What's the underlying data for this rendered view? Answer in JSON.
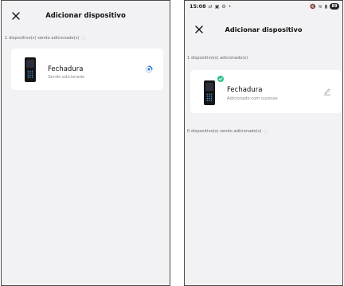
{
  "left_screen": {
    "title": "Adicionar dispositivo",
    "section_adding": "1 dispositivo(s) sendo adicionado(s)",
    "device": {
      "name": "Fechadura",
      "status": "Sendo adicionado",
      "image_icon": "door-lock-keypad",
      "state_icon": "loading-spinner"
    }
  },
  "right_screen": {
    "status_bar": {
      "time": "15:08",
      "left_icons": [
        "signal-arrows",
        "app-icon",
        "settings-icon",
        "dot"
      ],
      "battery": "89"
    },
    "title": "Adicionar dispositivo",
    "section_added": "1 dispositivo(s) adicionado(s)",
    "device": {
      "name": "Fechadura",
      "status": "Adicionado com sucesso",
      "image_icon": "door-lock-keypad",
      "badge_icon": "check-circle",
      "action_icon": "edit-pencil"
    },
    "section_adding": "0 dispositivo(s) sendo adicionado(s)"
  },
  "colors": {
    "background": "#f2f2f4",
    "card": "#ffffff",
    "success": "#2fbf8a",
    "spinner": "#1a6fd8",
    "border": "#4a4a4a"
  }
}
